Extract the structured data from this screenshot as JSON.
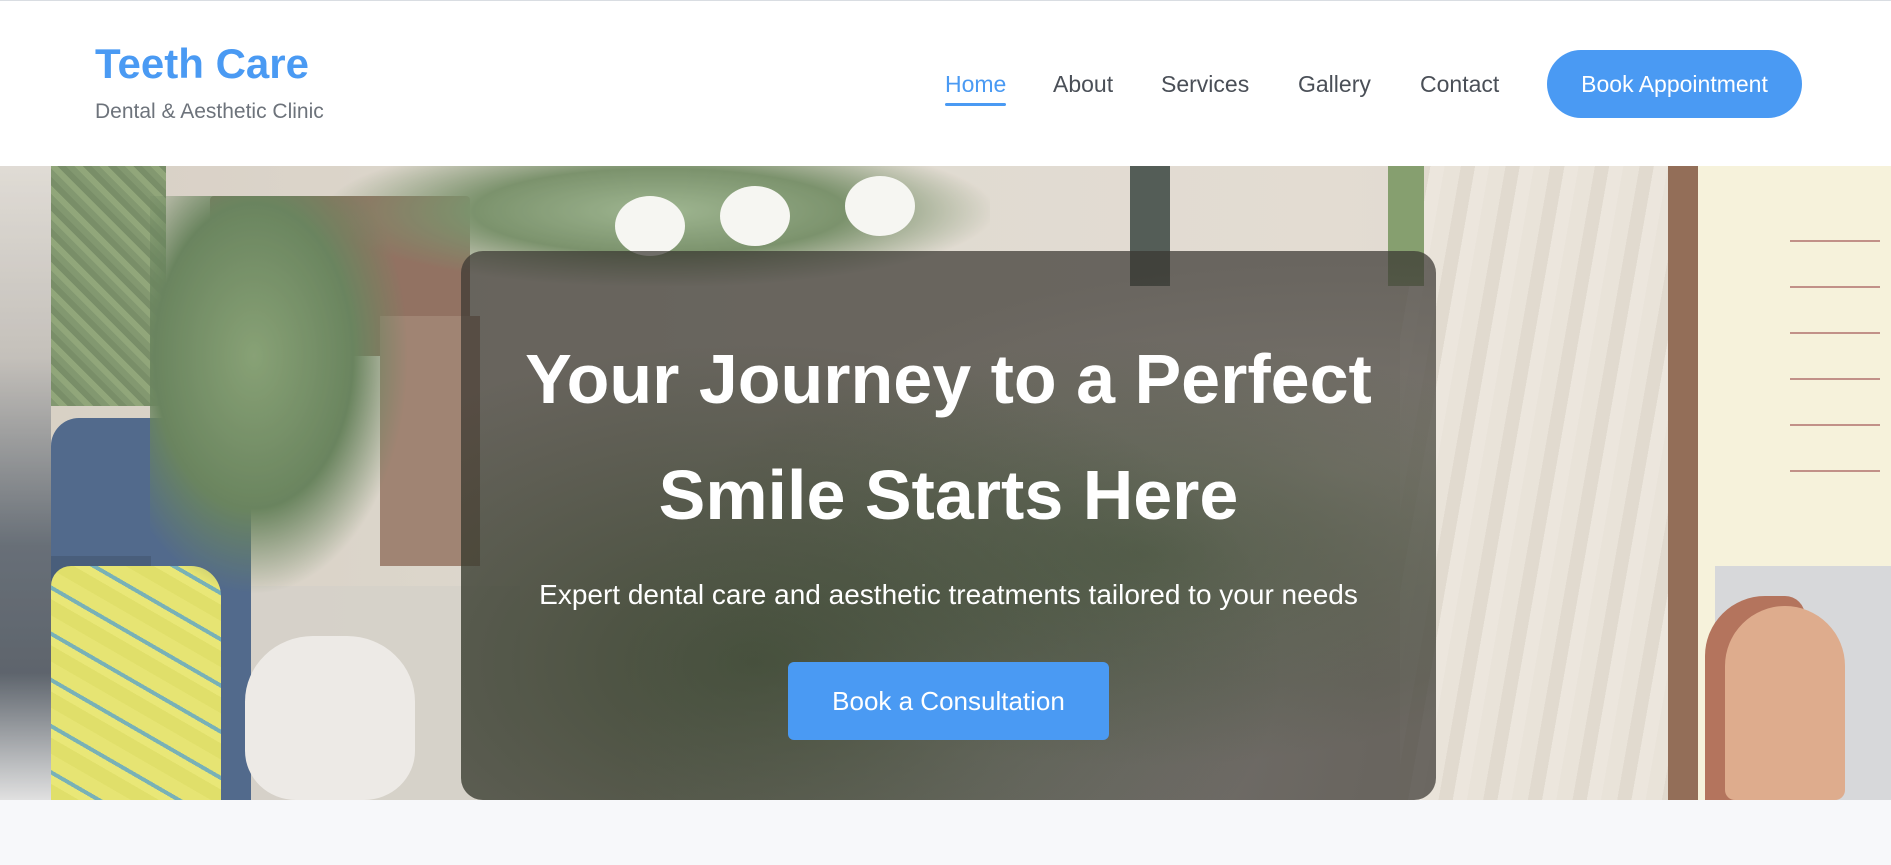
{
  "brand": {
    "title": "Teeth Care",
    "subtitle": "Dental & Aesthetic Clinic"
  },
  "nav": {
    "items": [
      {
        "label": "Home",
        "active": true
      },
      {
        "label": "About",
        "active": false
      },
      {
        "label": "Services",
        "active": false
      },
      {
        "label": "Gallery",
        "active": false
      },
      {
        "label": "Contact",
        "active": false
      }
    ],
    "cta_label": "Book Appointment"
  },
  "hero": {
    "title_line1": "Your Journey to a Perfect",
    "title_line2": "Smile Starts Here",
    "subtitle": "Expert dental care and aesthetic treatments tailored to your needs",
    "button_label": "Book a Consultation"
  },
  "colors": {
    "accent": "#4a9af3",
    "header_bg": "#ffffff",
    "page_bg": "#f7f8fa",
    "nav_text": "#4a4f57",
    "subtitle_text": "#6d737b"
  }
}
